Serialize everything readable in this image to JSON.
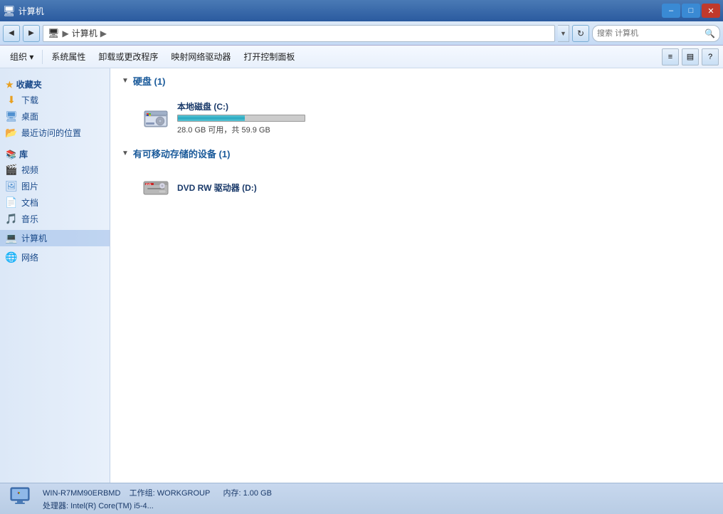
{
  "titlebar": {
    "title": "计算机",
    "min_label": "–",
    "max_label": "□",
    "close_label": "✕"
  },
  "addressbar": {
    "back_icon": "◀",
    "forward_icon": "▶",
    "breadcrumb_icon": "🖥",
    "breadcrumb_separator": "▶",
    "breadcrumb_text": "计算机",
    "dropdown_icon": "▼",
    "refresh_icon": "↻",
    "search_placeholder": "搜索 计算机"
  },
  "toolbar": {
    "organize_label": "组织 ▾",
    "properties_label": "系统属性",
    "uninstall_label": "卸载或更改程序",
    "map_drive_label": "映射网络驱动器",
    "control_panel_label": "打开控制面板",
    "view_icon": "≡",
    "pane_icon": "▤",
    "help_icon": "?"
  },
  "sidebar": {
    "favorites_label": "收藏夹",
    "favorites_icon": "★",
    "items": [
      {
        "label": "下载",
        "icon": "⬇",
        "color": "#e8a020"
      },
      {
        "label": "桌面",
        "icon": "🖥",
        "color": "#5090d0"
      },
      {
        "label": "最近访问的位置",
        "icon": "📂",
        "color": "#e8a020"
      }
    ],
    "library_label": "库",
    "library_icon": "📚",
    "library_items": [
      {
        "label": "视频",
        "icon": "🎬"
      },
      {
        "label": "图片",
        "icon": "🖼"
      },
      {
        "label": "文档",
        "icon": "📄"
      },
      {
        "label": "音乐",
        "icon": "🎵"
      }
    ],
    "computer_label": "计算机",
    "computer_icon": "💻",
    "network_label": "网络",
    "network_icon": "🌐"
  },
  "content": {
    "hard_disk_section": "硬盘 (1)",
    "removable_section": "有可移动存储的设备 (1)",
    "drives": [
      {
        "name": "本地磁盘 (C:)",
        "type": "hdd",
        "free_space": "28.0 GB",
        "total_space": "59.9 GB",
        "size_label": "28.0 GB 可用，共 59.9 GB",
        "progress_pct": 53
      }
    ],
    "removable_drives": [
      {
        "name": "DVD RW 驱动器 (D:)",
        "type": "dvd"
      }
    ]
  },
  "statusbar": {
    "computer_name": "WIN-R7MM90ERBMD",
    "workgroup_label": "工作组: WORKGROUP",
    "memory_label": "内存: 1.00 GB",
    "processor_label": "处理器: Intel(R) Core(TM) i5-4..."
  }
}
